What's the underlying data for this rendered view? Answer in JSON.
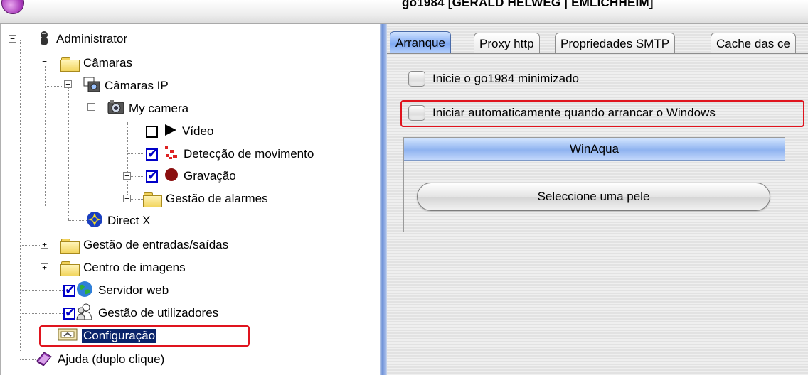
{
  "window": {
    "title": "go1984 [GERALD HELWEG | EMLICHHEIM]"
  },
  "tree": {
    "administrator": "Administrator",
    "cameras": "Câmaras",
    "ip_cameras": "Câmaras IP",
    "my_camera": "My camera",
    "video": "Vídeo",
    "motion_detection": "Detecção de movimento",
    "recording": "Gravação",
    "alarm_management": "Gestão de alarmes",
    "direct_x": "Direct X",
    "io_management": "Gestão de entradas/saídas",
    "image_center": "Centro de imagens",
    "web_server": "Servidor web",
    "user_management": "Gestão de utilizadores",
    "configuration": "Configuração",
    "help": "Ajuda (duplo clique)"
  },
  "tabs": [
    "Arranque",
    "Proxy http",
    "Propriedades SMTP",
    "Cache das ce"
  ],
  "options": {
    "start_minimized": "Inicie o go1984 minimizado",
    "auto_start_windows": "Iniciar automaticamente quando arrancar o Windows"
  },
  "skin_group": {
    "title": "WinAqua",
    "button": "Seleccione uma pele"
  },
  "colors": {
    "highlight_red": "#e0141e",
    "selection_blue": "#0a246a",
    "checkbox_blue": "#0000c8",
    "splitter_blue": "#6b8fd6"
  }
}
